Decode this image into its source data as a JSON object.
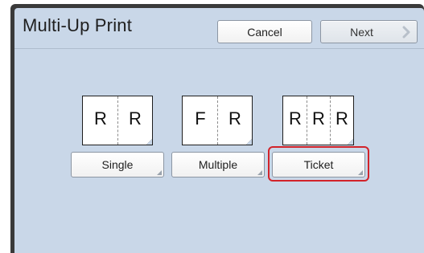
{
  "header": {
    "title": "Multi-Up Print",
    "cancel_label": "Cancel",
    "next_label": "Next"
  },
  "options": [
    {
      "label": "Single",
      "letters": [
        "R",
        "R"
      ],
      "selected": false
    },
    {
      "label": "Multiple",
      "letters": [
        "F",
        "R"
      ],
      "selected": false
    },
    {
      "label": "Ticket",
      "letters": [
        "R",
        "R",
        "R"
      ],
      "selected": true
    }
  ],
  "colors": {
    "panel": "#c9d7e8",
    "selection": "#d2232a",
    "frame": "#3a3a3a"
  }
}
